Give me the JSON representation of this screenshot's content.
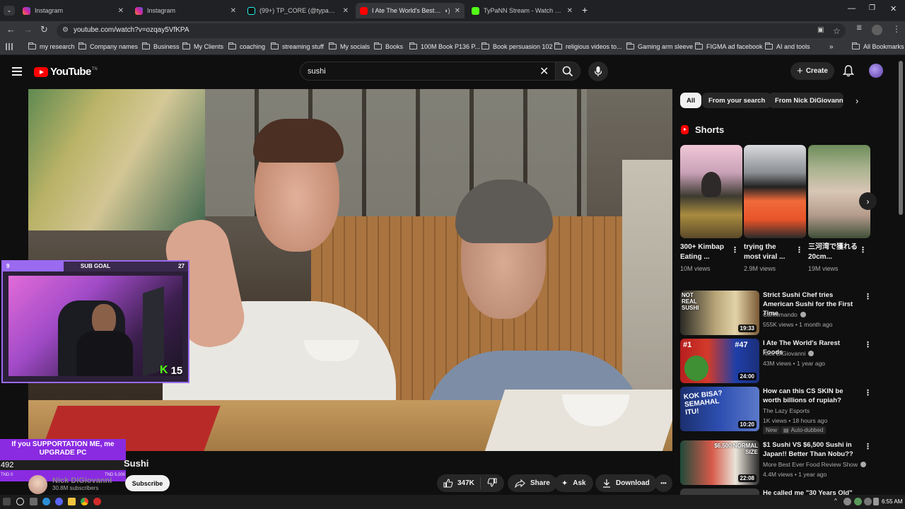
{
  "browser": {
    "tabs": [
      {
        "label": "Instagram",
        "favicon_color": "#d6249f",
        "active": false
      },
      {
        "label": "Instagram",
        "favicon_color": "#d6249f",
        "active": false
      },
      {
        "label": "(99+) TP_CORE (@typann_core)",
        "favicon_color": "#25f4ee",
        "active": false
      },
      {
        "label": "I Ate The World's Best Sushi",
        "favicon_color": "#ff0000",
        "active": true
      },
      {
        "label": "TyPaNN Stream - Watch Live on",
        "favicon_color": "#53fc18",
        "active": false
      }
    ],
    "new_tab_label": "+",
    "url": "youtube.com/watch?v=ozqay5VfKPA",
    "bookmarks": [
      "my research",
      "Company names",
      "Business",
      "My Clients",
      "coaching",
      "streaming stuff",
      "My socials",
      "Books",
      "100M Book P136 P...",
      "Book persuasion 102",
      "religious videos to...",
      "Gaming arm sleeve",
      "FIGMA ad facebook",
      "AI and tools"
    ],
    "all_bookmarks": "All Bookmarks"
  },
  "youtube": {
    "logo_text": "YouTube",
    "logo_tm": "TN",
    "search_query": "sushi",
    "create_label": "Create",
    "accent": "#ff0000"
  },
  "overlay": {
    "sub_goal_label": "SUB GOAL",
    "sub_goal_current": "9",
    "sub_goal_target": "27",
    "kick_count": "15",
    "support_text": "If you SUPPORTATION ME, me UPGRADE PC",
    "support_amount": "492",
    "support_min": "TND 0",
    "support_max": "TND 5,000"
  },
  "video": {
    "title_tail": "Sushi",
    "channel_name": "Nick DiGiovanni",
    "subscribers": "30.8M subscribers",
    "subscribe_label": "Subscribe",
    "likes": "347K",
    "share_label": "Share",
    "ask_label": "Ask",
    "download_label": "Download",
    "more_label": "•••"
  },
  "sidebar": {
    "chips": [
      "All",
      "From your search",
      "From Nick DiGiovanni"
    ],
    "shorts_heading": "Shorts",
    "shorts": [
      {
        "title": "300+ Kimbap Eating ...",
        "views": "10M views"
      },
      {
        "title": "trying the most viral ...",
        "views": "2.9M views"
      },
      {
        "title": "三河湾で獲れる20cm...",
        "views": "19M views"
      }
    ],
    "videos": [
      {
        "title": "Strict Sushi Chef tries American Sushi for the First Time",
        "channel": "Cantomando",
        "meta": "555K views • 1 month ago",
        "duration": "19:33",
        "thumb_text": "NOT REAL SUSHI"
      },
      {
        "title": "I Ate The World's Rarest Foods",
        "channel": "Nick DiGiovanni",
        "meta": "43M views • 1 year ago",
        "duration": "24:00",
        "thumb_text": "#1 #47"
      },
      {
        "title": "How can this CS SKIN be worth billions of rupiah?",
        "channel": "The Lazy Esports",
        "meta": "1K views • 18 hours ago",
        "duration": "10:20",
        "thumb_text": "KOK BISA? SEMAHAL ITU!",
        "badges": [
          "New",
          "Auto-dubbed"
        ]
      },
      {
        "title": "$1 Sushi VS $6,500 Sushi in Japan!! Better Than Nobu??",
        "channel": "More Best Ever Food Review Show",
        "meta": "4.4M views • 1 year ago",
        "duration": "22:08",
        "thumb_text": "$6,500 NORMAL SIZE"
      },
      {
        "title": "He called me \"30 Years Old\"",
        "channel": "",
        "meta": "",
        "duration": "",
        "thumb_text": ""
      }
    ]
  },
  "taskbar": {
    "time": "6:55 AM"
  }
}
